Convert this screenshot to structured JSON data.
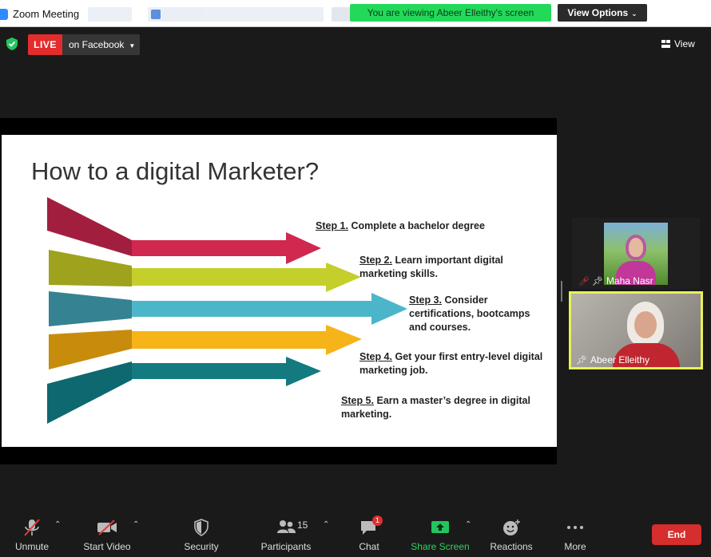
{
  "window": {
    "title": "Zoom Meeting",
    "viewing_banner": "You are viewing Abeer Elleithy's screen",
    "view_options": "View Options"
  },
  "meeting_bar": {
    "live_label": "LIVE",
    "stream_target": "on Facebook",
    "view_label": "View"
  },
  "slide": {
    "title": "How to a digital Marketer?",
    "steps": [
      {
        "label": "Step 1.",
        "line1": "Complete a bachelor degree",
        "line2": "",
        "color": "#d0284f"
      },
      {
        "label": "Step 2.",
        "line1": "Learn important digital",
        "line2": "marketing skills.",
        "color": "#c4cf2b"
      },
      {
        "label": "Step 3.",
        "line1": "Consider",
        "line2": "certifications, bootcamps",
        "line3": "and courses.",
        "color": "#4bb6c9"
      },
      {
        "label": "Step 4.",
        "line1": "Get your first entry-level digital",
        "line2": "marketing job.",
        "color": "#f6b418"
      },
      {
        "label": "Step 5.",
        "line1": "Earn a master’s degree in digital",
        "line2": "marketing.",
        "color": "#137a80"
      }
    ]
  },
  "participants": [
    {
      "name": "Maha Nasr",
      "muted": true,
      "pinned": true
    },
    {
      "name": "Abeer Elleithy",
      "muted": false,
      "pinned": true,
      "active_speaker": true
    }
  ],
  "toolbar": {
    "unmute": "Unmute",
    "start_video": "Start Video",
    "security": "Security",
    "participants": "Participants",
    "participants_count": "15",
    "chat": "Chat",
    "chat_badge": "1",
    "share_screen": "Share Screen",
    "reactions": "Reactions",
    "more": "More",
    "end": "End"
  },
  "colors": {
    "live_red": "#e32d2d",
    "banner_green": "#23d959",
    "active_speaker_border": "#e8f255",
    "end_red": "#d62d2d"
  }
}
